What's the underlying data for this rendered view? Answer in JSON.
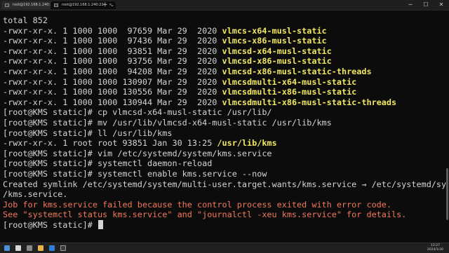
{
  "window": {
    "tabs": [
      {
        "title": "root@192.168.1.240:22",
        "active": false
      },
      {
        "title": "root@192.168.1.240:22",
        "active": true
      }
    ],
    "new_tab": "+",
    "dropdown": "⌄",
    "minimize": "─",
    "maximize": "☐",
    "close": "✕"
  },
  "terminal": {
    "lines": [
      [
        {
          "t": "total 852"
        }
      ],
      [
        {
          "t": "-rwxr-xr-x. 1 1000 1000  97659 Mar 29  2020 "
        },
        {
          "t": "vlmcs-x64-musl-static",
          "s": "exec"
        }
      ],
      [
        {
          "t": "-rwxr-xr-x. 1 1000 1000  97436 Mar 29  2020 "
        },
        {
          "t": "vlmcs-x86-musl-static",
          "s": "exec"
        }
      ],
      [
        {
          "t": "-rwxr-xr-x. 1 1000 1000  93851 Mar 29  2020 "
        },
        {
          "t": "vlmcsd-x64-musl-static",
          "s": "exec"
        }
      ],
      [
        {
          "t": "-rwxr-xr-x. 1 1000 1000  93756 Mar 29  2020 "
        },
        {
          "t": "vlmcsd-x86-musl-static",
          "s": "exec"
        }
      ],
      [
        {
          "t": "-rwxr-xr-x. 1 1000 1000  94208 Mar 29  2020 "
        },
        {
          "t": "vlmcsd-x86-musl-static-threads",
          "s": "exec"
        }
      ],
      [
        {
          "t": "-rwxr-xr-x. 1 1000 1000 130907 Mar 29  2020 "
        },
        {
          "t": "vlmcsdmulti-x64-musl-static",
          "s": "exec"
        }
      ],
      [
        {
          "t": "-rwxr-xr-x. 1 1000 1000 130556 Mar 29  2020 "
        },
        {
          "t": "vlmcsdmulti-x86-musl-static",
          "s": "exec"
        }
      ],
      [
        {
          "t": "-rwxr-xr-x. 1 1000 1000 130944 Mar 29  2020 "
        },
        {
          "t": "vlmcsdmulti-x86-musl-static-threads",
          "s": "exec"
        }
      ],
      [
        {
          "t": "[root@KMS static]# cp vlmcsd-x64-musl-static /usr/lib/"
        }
      ],
      [
        {
          "t": "[root@KMS static]# mv /usr/lib/vlmcsd-x64-musl-static /usr/lib/kms"
        }
      ],
      [
        {
          "t": "[root@KMS static]# ll /usr/lib/kms"
        }
      ],
      [
        {
          "t": "-rwxr-xr-x. 1 root root 93851 Jan 30 13:25 "
        },
        {
          "t": "/usr/lib/kms",
          "s": "exec"
        }
      ],
      [
        {
          "t": "[root@KMS static]# vim /etc/systemd/system/kms.service"
        }
      ],
      [
        {
          "t": "[root@KMS static]# systemctl daemon-reload"
        }
      ],
      [
        {
          "t": "[root@KMS static]# systemctl enable kms.service --now"
        }
      ],
      [
        {
          "t": "Created symlink /etc/systemd/system/multi-user.target.wants/kms.service → /etc/systemd/system"
        }
      ],
      [
        {
          "t": "/kms.service."
        }
      ],
      [
        {
          "t": "Job for kms.service failed because the control process exited with error code.",
          "s": "err"
        }
      ],
      [
        {
          "t": "See \"systemctl status kms.service\" and \"journalctl -xeu kms.service\" for details.",
          "s": "err"
        }
      ],
      [
        {
          "t": "[root@KMS static]# "
        }
      ]
    ]
  },
  "taskbar": {
    "clock_time": "13:27",
    "clock_date": "2024/1/30"
  },
  "colors": {
    "background": "#0c0c0c",
    "text": "#d4d4d4",
    "exec": "#f0e660",
    "error": "#f2785a"
  }
}
